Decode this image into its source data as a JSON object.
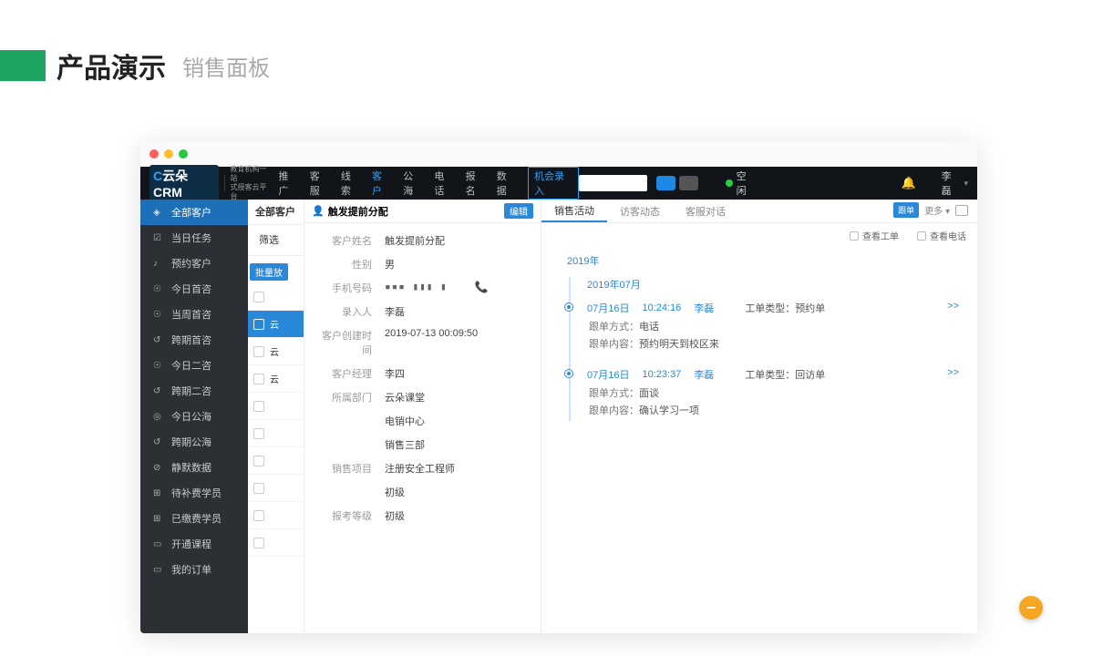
{
  "page": {
    "title": "产品演示",
    "subtitle": "销售面板"
  },
  "brand": {
    "name": "云朵CRM",
    "tag1": "教育机构一站",
    "tag2": "式授客云平台"
  },
  "nav": {
    "items": [
      "推广",
      "客服",
      "线索",
      "客户",
      "公海",
      "电话",
      "报名",
      "数据"
    ],
    "active": 3,
    "opportunity_btn": "机会录入"
  },
  "top": {
    "status": "空闲",
    "user": "李磊"
  },
  "sidebar": {
    "items": [
      {
        "icon": "◈",
        "label": "全部客户"
      },
      {
        "icon": "☑",
        "label": "当日任务"
      },
      {
        "icon": "♪",
        "label": "预约客户"
      },
      {
        "icon": "☉",
        "label": "今日首咨"
      },
      {
        "icon": "☉",
        "label": "当周首咨"
      },
      {
        "icon": "↺",
        "label": "跨期首咨"
      },
      {
        "icon": "☉",
        "label": "今日二咨"
      },
      {
        "icon": "↺",
        "label": "跨期二咨"
      },
      {
        "icon": "◎",
        "label": "今日公海"
      },
      {
        "icon": "↺",
        "label": "跨期公海"
      },
      {
        "icon": "⊘",
        "label": "静默数据"
      },
      {
        "icon": "⊞",
        "label": "待补费学员"
      },
      {
        "icon": "⊞",
        "label": "已缴费学员"
      },
      {
        "icon": "▭",
        "label": "开通课程"
      },
      {
        "icon": "▭",
        "label": "我的订单"
      }
    ],
    "active": 0
  },
  "mid": {
    "header": "全部客户",
    "filter_label": "筛选",
    "bulk_tag": "批量放",
    "rows": [
      "",
      "云",
      "云",
      "云",
      "",
      "",
      "",
      "",
      "",
      ""
    ],
    "selected": 1
  },
  "detail": {
    "title": "触发提前分配",
    "edit_btn": "编辑",
    "fields": [
      {
        "label": "客户姓名",
        "value": "触发提前分配"
      },
      {
        "label": "性别",
        "value": "男"
      },
      {
        "label": "手机号码",
        "value": "▪▪▪ ▮▮▮ ▮",
        "phone": true
      },
      {
        "label": "录入人",
        "value": "李磊"
      },
      {
        "label": "客户创建时间",
        "value": "2019-07-13 00:09:50"
      },
      {
        "label": "客户经理",
        "value": "李四"
      },
      {
        "label": "所属部门",
        "value": "云朵课堂"
      },
      {
        "label": "",
        "value": "电销中心"
      },
      {
        "label": "",
        "value": "销售三部"
      },
      {
        "label": "销售项目",
        "value": "注册安全工程师"
      },
      {
        "label": "",
        "value": "初级"
      },
      {
        "label": "报考等级",
        "value": "初级"
      }
    ]
  },
  "activity": {
    "tabs": [
      "销售活动",
      "访客动态",
      "客服对话"
    ],
    "active": 0,
    "toolbar": {
      "follow": "跟单",
      "more": "更多 ▾"
    },
    "filters": {
      "view_ticket": "查看工单",
      "view_phone": "查看电话"
    },
    "year": "2019年",
    "month": "2019年07月",
    "entries": [
      {
        "date": "07月16日",
        "time": "10:24:16",
        "user": "李磊",
        "ticket_type_label": "工单类型：",
        "ticket_type": "预约单",
        "method_label": "跟单方式：",
        "method": "电话",
        "content_label": "跟单内容：",
        "content": "预约明天到校区来",
        "more": ">>"
      },
      {
        "date": "07月16日",
        "time": "10:23:37",
        "user": "李磊",
        "ticket_type_label": "工单类型：",
        "ticket_type": "回访单",
        "method_label": "跟单方式：",
        "method": "面谈",
        "content_label": "跟单内容：",
        "content": "确认学习一项",
        "more": ">>"
      }
    ]
  }
}
